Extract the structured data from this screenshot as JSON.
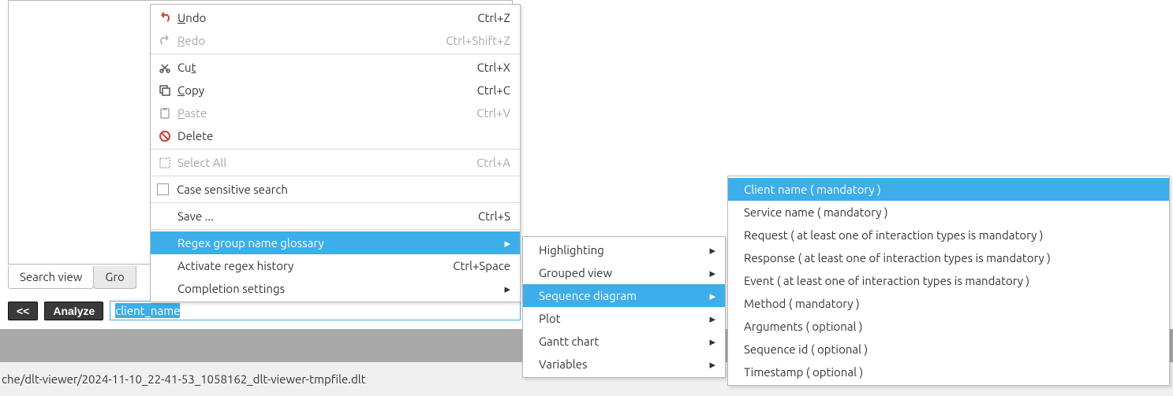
{
  "tabs": {
    "search_view": "Search view",
    "grouped_view": "Gro"
  },
  "toolbar": {
    "back": "<<",
    "analyze": "Analyze",
    "regex_value": "client_name"
  },
  "status": {
    "path": "che/dlt-viewer/2024-11-10_22-41-53_1058162_dlt-viewer-tmpfile.dlt"
  },
  "menu1": [
    {
      "icon": "undo",
      "label": "Undo",
      "underline": "U",
      "accel": "Ctrl+Z",
      "disabled": false
    },
    {
      "icon": "redo",
      "label": "Redo",
      "underline": "R",
      "accel": "Ctrl+Shift+Z",
      "disabled": true
    },
    {
      "sep": true
    },
    {
      "icon": "cut",
      "label": "Cut",
      "underline": "t",
      "accel": "Ctrl+X",
      "disabled": false
    },
    {
      "icon": "copy",
      "label": "Copy",
      "underline": "C",
      "accel": "Ctrl+C",
      "disabled": false
    },
    {
      "icon": "paste",
      "label": "Paste",
      "underline": "P",
      "accel": "Ctrl+V",
      "disabled": true
    },
    {
      "icon": "delete",
      "label": "Delete",
      "accel": "",
      "disabled": false
    },
    {
      "sep": true
    },
    {
      "icon": "selectall",
      "label": "Select All",
      "accel": "Ctrl+A",
      "disabled": true
    },
    {
      "sep": true
    },
    {
      "checkbox": true,
      "label": "Case sensitive search",
      "disabled": false
    },
    {
      "sep": true
    },
    {
      "label": "Save ...",
      "accel": "Ctrl+S",
      "disabled": false
    },
    {
      "sep": true
    },
    {
      "label": "Regex group name glossary",
      "submenu": true,
      "highlight": true
    },
    {
      "label": "Activate regex history",
      "accel": "Ctrl+Space",
      "disabled": false
    },
    {
      "label": "Completion settings",
      "submenu": true,
      "disabled": false
    }
  ],
  "menu2": [
    {
      "label": "Highlighting",
      "submenu": true
    },
    {
      "label": "Grouped view",
      "submenu": true
    },
    {
      "label": "Sequence diagram",
      "submenu": true,
      "highlight": true
    },
    {
      "label": "Plot",
      "submenu": true
    },
    {
      "label": "Gantt chart",
      "submenu": true
    },
    {
      "label": "Variables",
      "submenu": true
    }
  ],
  "menu3": [
    {
      "label": "Client name ( mandatory )",
      "highlight": true
    },
    {
      "label": "Service name ( mandatory )"
    },
    {
      "label": "Request ( at least one of interaction types is mandatory )"
    },
    {
      "label": "Response ( at least one of interaction types is mandatory )"
    },
    {
      "label": "Event ( at least one of interaction types is mandatory )"
    },
    {
      "label": "Method ( mandatory )"
    },
    {
      "label": "Arguments ( optional )"
    },
    {
      "label": "Sequence id ( optional )"
    },
    {
      "label": "Timestamp ( optional )"
    }
  ]
}
